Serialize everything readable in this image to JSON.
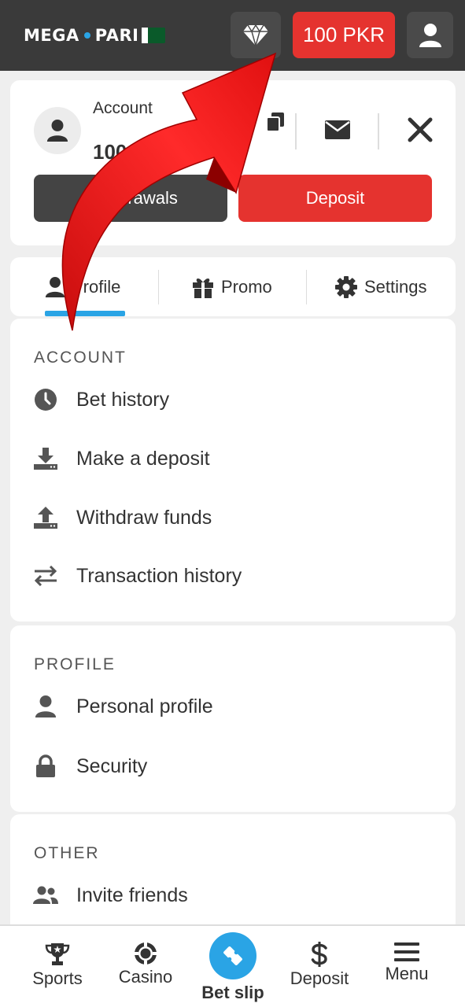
{
  "header": {
    "logo_text_left": "MEGA",
    "logo_text_right": "PARI",
    "balance": "100 PKR",
    "icons": [
      "diamond-icon",
      "user-icon"
    ]
  },
  "account": {
    "title": "Account",
    "amount": "100",
    "secondary_button": "Withdrawals",
    "deposit_button": "Deposit"
  },
  "tabs": [
    {
      "label": "Profile",
      "icon": "user-icon",
      "active": true
    },
    {
      "label": "Promo",
      "icon": "gift-icon"
    },
    {
      "label": "Settings",
      "icon": "gear-icon"
    }
  ],
  "sections": {
    "account": {
      "title": "ACCOUNT",
      "items": [
        {
          "label": "Bet history",
          "icon": "clock-icon"
        },
        {
          "label": "Make a deposit",
          "icon": "download-icon"
        },
        {
          "label": "Withdraw funds",
          "icon": "upload-icon"
        },
        {
          "label": "Transaction history",
          "icon": "transfer-icon"
        }
      ]
    },
    "profile": {
      "title": "PROFILE",
      "items": [
        {
          "label": "Personal profile",
          "icon": "user-icon"
        },
        {
          "label": "Security",
          "icon": "lock-icon"
        }
      ]
    },
    "other": {
      "title": "OTHER",
      "items": [
        {
          "label": "Invite friends",
          "icon": "users-icon"
        }
      ]
    }
  },
  "bottom_nav": [
    {
      "label": "Sports",
      "icon": "trophy-icon"
    },
    {
      "label": "Casino",
      "icon": "chip-icon"
    },
    {
      "label": "Bet slip",
      "icon": "ticket-icon",
      "active": true
    },
    {
      "label": "Deposit",
      "icon": "dollar-icon"
    },
    {
      "label": "Menu",
      "icon": "hamburger-icon"
    }
  ],
  "colors": {
    "header_bg": "#3a3a3a",
    "accent_red": "#e5332f",
    "accent_blue": "#2aa4e5",
    "page_bg": "#efefef"
  }
}
